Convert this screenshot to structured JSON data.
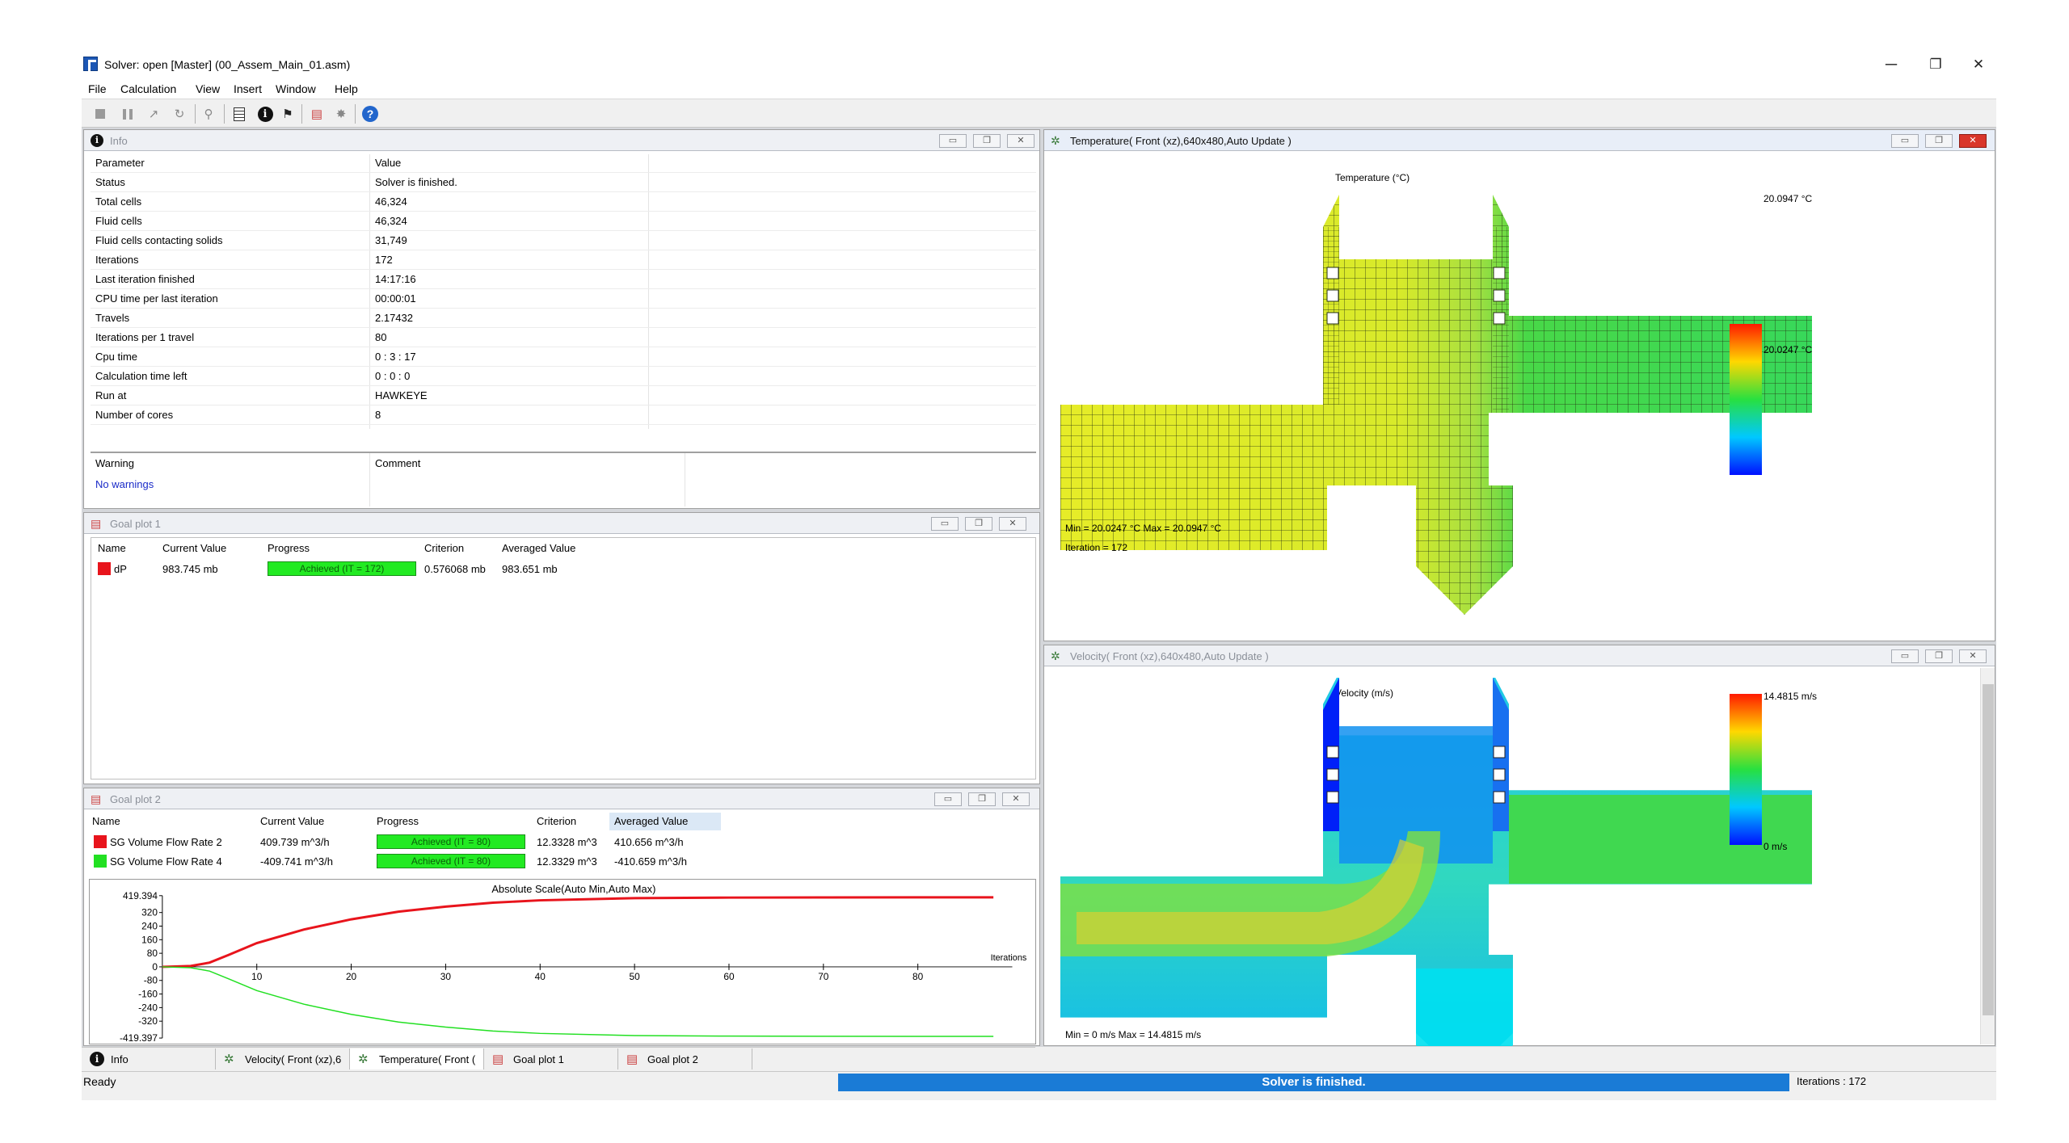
{
  "window": {
    "title": "Solver: open [Master] (00_Assem_Main_01.asm)",
    "minimize": "─",
    "restore": "❐",
    "close": "✕"
  },
  "menu": [
    "File",
    "Calculation",
    "View",
    "Insert",
    "Window",
    "Help"
  ],
  "toolbar_icons": [
    "stop-icon",
    "pause-icon",
    "arrow-icon",
    "refresh-icon",
    "probe-icon",
    "document-icon",
    "info-icon",
    "flag-icon",
    "goal-plot-icon",
    "gear-icon",
    "help-icon"
  ],
  "info": {
    "title": "Info",
    "headers": [
      "Parameter",
      "Value"
    ],
    "rows": [
      [
        "Status",
        "Solver is finished."
      ],
      [
        "Total cells",
        "46,324"
      ],
      [
        "Fluid cells",
        "46,324"
      ],
      [
        "Fluid cells contacting solids",
        "31,749"
      ],
      [
        "Iterations",
        "172"
      ],
      [
        "Last iteration finished",
        "14:17:16"
      ],
      [
        "CPU time per last iteration",
        "00:00:01"
      ],
      [
        "Travels",
        "2.17432"
      ],
      [
        "Iterations per 1 travel",
        "80"
      ],
      [
        "Cpu time",
        "0 : 3 : 17"
      ],
      [
        "Calculation time left",
        "0 : 0 : 0"
      ],
      [
        "Run at",
        "HAWKEYE"
      ],
      [
        "Number of cores",
        "8"
      ]
    ],
    "warn_headers": [
      "Warning",
      "Comment"
    ],
    "warning": "No warnings"
  },
  "goal1": {
    "title": "Goal plot 1",
    "headers": [
      "Name",
      "Current Value",
      "Progress",
      "Criterion",
      "Averaged Value"
    ],
    "rows": [
      {
        "name": "dP",
        "current": "983.745 mb",
        "progress": "Achieved (IT = 172)",
        "progress_fraction": 1.0,
        "criterion": "0.576068 mb",
        "avg": "983.651 mb",
        "color": "#e8141c"
      }
    ]
  },
  "goal2": {
    "title": "Goal plot 2",
    "headers": [
      "Name",
      "Current Value",
      "Progress",
      "Criterion",
      "Averaged Value"
    ],
    "rows": [
      {
        "name": "SG Volume Flow Rate 2",
        "current": "409.739 m^3/h",
        "progress": "Achieved (IT = 80)",
        "progress_fraction": 1.0,
        "criterion": "12.3328 m^3",
        "avg": "410.656 m^3/h",
        "color": "#e8141c"
      },
      {
        "name": "SG Volume Flow Rate 4",
        "current": "-409.741 m^3/h",
        "progress": "Achieved (IT = 80)",
        "progress_fraction": 1.0,
        "criterion": "12.3329 m^3",
        "avg": "-410.659 m^3/h",
        "color": "#22e022"
      }
    ]
  },
  "chart_data": {
    "type": "line",
    "title": "Absolute Scale(Auto Min,Auto Max)",
    "xlabel": "Iterations",
    "ylabel": "",
    "xlim": [
      0,
      90
    ],
    "ylim": [
      -419.397,
      419.394
    ],
    "y_ticks": [
      "419.394",
      "320",
      "240",
      "160",
      "80",
      "0",
      "-80",
      "-160",
      "-240",
      "-320",
      "-419.397"
    ],
    "x_ticks": [
      "10",
      "20",
      "30",
      "40",
      "50",
      "60",
      "70",
      "80"
    ],
    "series": [
      {
        "name": "SG Volume Flow Rate 2",
        "color": "#e8141c",
        "x": [
          0,
          3,
          5,
          7,
          10,
          15,
          20,
          25,
          30,
          35,
          40,
          50,
          60,
          70,
          80,
          88
        ],
        "y": [
          0,
          5,
          25,
          70,
          140,
          220,
          280,
          325,
          355,
          378,
          392,
          405,
          408,
          409,
          409.7,
          409.7
        ]
      },
      {
        "name": "SG Volume Flow Rate 4",
        "color": "#22e022",
        "x": [
          0,
          3,
          5,
          7,
          10,
          15,
          20,
          25,
          30,
          35,
          40,
          50,
          60,
          70,
          80,
          88
        ],
        "y": [
          0,
          -5,
          -25,
          -70,
          -140,
          -220,
          -280,
          -325,
          -355,
          -378,
          -392,
          -405,
          -408,
          -409,
          -409.7,
          -409.7
        ]
      }
    ]
  },
  "temperature": {
    "title": "Temperature( Front (xz),640x480,Auto Update )",
    "plot_title": "Temperature (°C)",
    "max_label": "20.0947 °C",
    "min_label": "20.0247 °C",
    "minmax": "Min = 20.0247 °C   Max = 20.0947 °C",
    "iteration": "Iteration = 172"
  },
  "velocity": {
    "title": "Velocity( Front (xz),640x480,Auto Update )",
    "plot_title": "Velocity (m/s)",
    "max_label": "14.4815 m/s",
    "min_label": "0 m/s",
    "minmax": "Min = 0 m/s   Max = 14.4815 m/s"
  },
  "tabs": [
    "Info",
    "Velocity( Front (xz),6",
    "Temperature( Front (",
    "Goal plot 1",
    "Goal plot 2"
  ],
  "status": {
    "left": "Ready",
    "center": "Solver is finished.",
    "right": "Iterations : 172"
  }
}
